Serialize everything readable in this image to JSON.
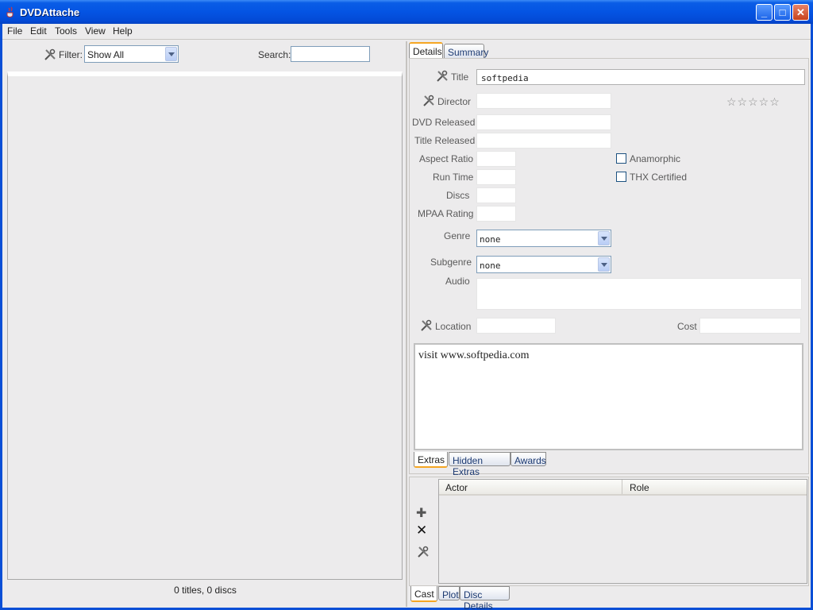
{
  "window": {
    "title": "DVDAttache"
  },
  "menu": [
    "File",
    "Edit",
    "Tools",
    "View",
    "Help"
  ],
  "left": {
    "filter_label": "Filter:",
    "filter_value": "Show All",
    "search_label": "Search:",
    "search_value": "",
    "status": "0 titles, 0 discs"
  },
  "right": {
    "tabs": [
      "Details",
      "Summary"
    ],
    "fields": {
      "title_label": "Title",
      "title_value": "softpedia",
      "director_label": "Director",
      "dvd_released_label": "DVD Released",
      "title_released_label": "Title Released",
      "aspect_ratio_label": "Aspect Ratio",
      "run_time_label": "Run Time",
      "discs_label": "Discs",
      "mpaa_rating_label": "MPAA Rating",
      "genre_label": "Genre",
      "genre_value": "none",
      "subgenre_label": "Subgenre",
      "subgenre_value": "none",
      "audio_label": "Audio",
      "location_label": "Location",
      "cost_label": "Cost",
      "anamorphic_label": "Anamorphic",
      "thx_label": "THX Certified",
      "rating_stars": "☆☆☆☆☆"
    },
    "notes_text": "visit www.softpedia.com",
    "extras_tabs": [
      "Extras",
      "Hidden Extras",
      "Awards"
    ],
    "cast_columns": [
      "Actor",
      "Role"
    ],
    "bottom_tabs": [
      "Cast",
      "Plot",
      "Disc Details"
    ]
  },
  "colors": {
    "titlebar": "#0454e3",
    "active_tab_accent": "#f5a623",
    "panel_bg": "#ecebec"
  }
}
